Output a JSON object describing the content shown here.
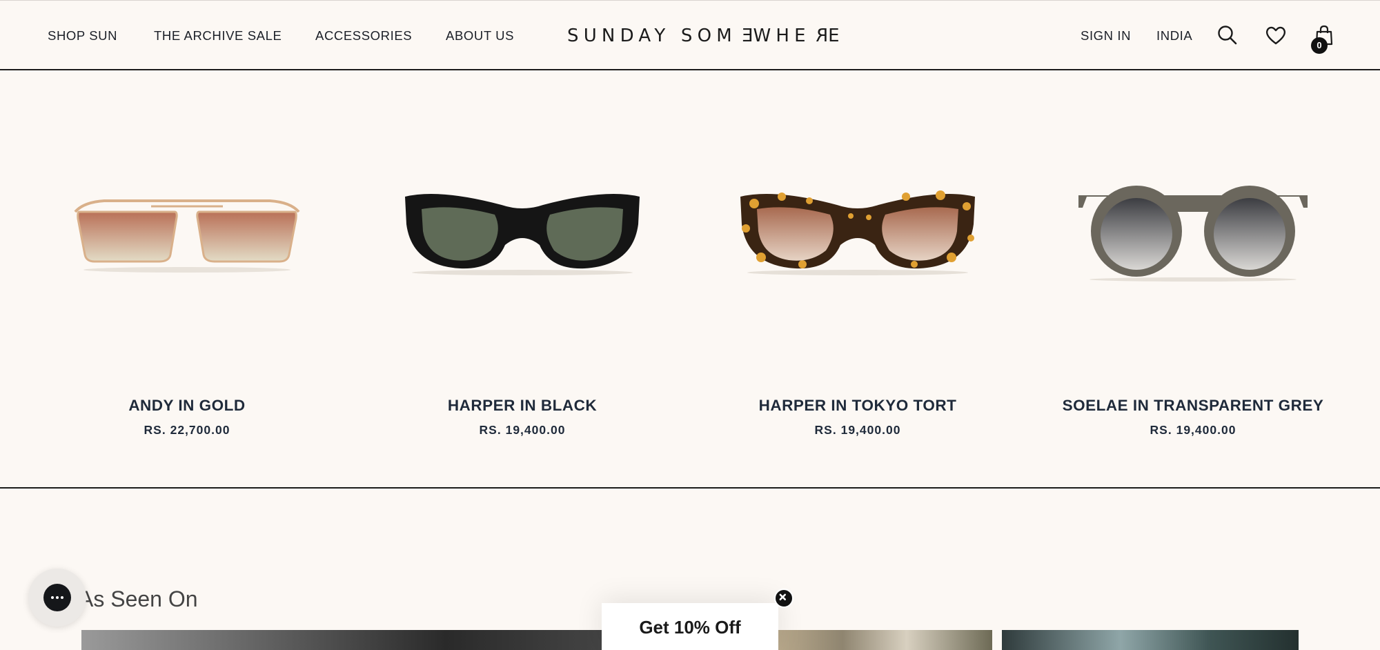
{
  "header": {
    "nav": [
      "SHOP SUN",
      "THE ARCHIVE SALE",
      "ACCESSORIES",
      "ABOUT US"
    ],
    "logo": {
      "part1": "SUNDAY SOM",
      "flipped": "E",
      "part2": "WHE",
      "flipped2": "R",
      "part3": "E"
    },
    "sign_in": "SIGN IN",
    "region": "INDIA",
    "icons": [
      "search-icon",
      "heart-icon",
      "bag-icon"
    ],
    "cart_count": "0"
  },
  "products": [
    {
      "name": "ANDY IN GOLD",
      "price": "RS. 22,700.00",
      "frame_color": "#d9b08a",
      "lens_color": "#c48a6a"
    },
    {
      "name": "HARPER IN BLACK",
      "price": "RS. 19,400.00",
      "frame_color": "#151515",
      "lens_color": "#5f6b57"
    },
    {
      "name": "HARPER IN TOKYO TORT",
      "price": "RS. 19,400.00",
      "frame_color": "#3a2413",
      "lens_color": "#b98064"
    },
    {
      "name": "SOELAE IN TRANSPARENT GREY",
      "price": "RS. 19,400.00",
      "frame_color": "#6b675d",
      "lens_color": "#55565a"
    }
  ],
  "as_seen_on": {
    "title": "As Seen On"
  },
  "promo": {
    "label": "Get 10% Off"
  },
  "colors": {
    "background": "#fcf8f4",
    "text": "#1f2a3a",
    "divider": "#1b1b1b"
  }
}
